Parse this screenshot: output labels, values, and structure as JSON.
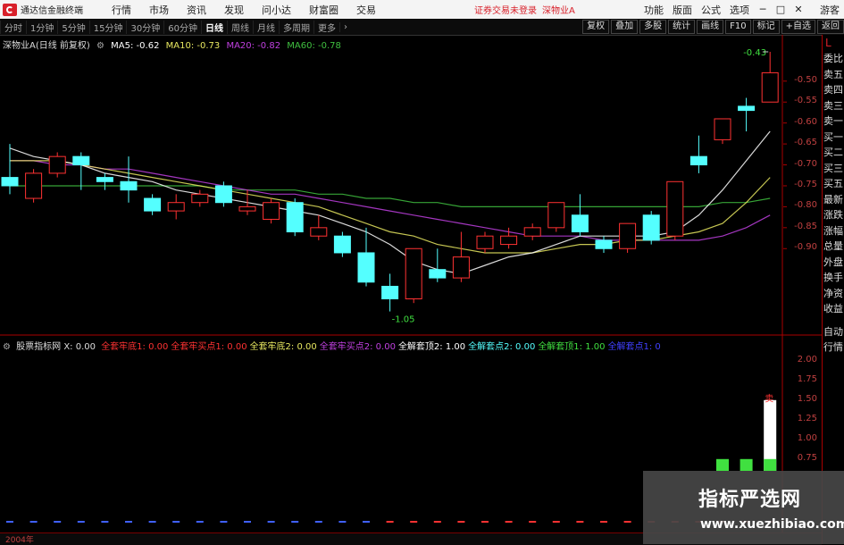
{
  "app": {
    "name": "通达信金融终端"
  },
  "menu": [
    "行情",
    "市场",
    "资讯",
    "发现",
    "问小达",
    "财富圈",
    "交易"
  ],
  "status": {
    "login": "证券交易未登录",
    "stock": "深物业A"
  },
  "menu_right": [
    "功能",
    "版面",
    "公式",
    "选项"
  ],
  "user": "游客",
  "periods": [
    "分时",
    "1分钟",
    "5分钟",
    "15分钟",
    "30分钟",
    "60分钟",
    "日线",
    "周线",
    "月线",
    "多周期",
    "更多"
  ],
  "active_period": "日线",
  "toolbar_right": [
    "复权",
    "叠加",
    "多股",
    "统计",
    "画线",
    "F10",
    "标记",
    "+自选",
    "返回"
  ],
  "sidebar": [
    "委比",
    "卖五",
    "卖四",
    "卖三",
    "卖一",
    "买一",
    "买二",
    "买三",
    "买五",
    "最新",
    "涨跌",
    "涨幅",
    "总量",
    "外盘",
    "换手",
    "净资",
    "收益",
    "自动",
    "行情"
  ],
  "sidebar_L": "L",
  "main_info": {
    "title": "深物业A(日线 前复权)",
    "ma5": "MA5: -0.62",
    "ma10": "MA10: -0.73",
    "ma20": "MA20: -0.82",
    "ma60": "MA60: -0.78"
  },
  "colors": {
    "ma5": "#ffffff",
    "ma10": "#e8e860",
    "ma20": "#c040e0",
    "ma60": "#40c040",
    "up": "#ff3232",
    "down": "#54ffff"
  },
  "price_axis": [
    "-0.50",
    "-0.55",
    "-0.60",
    "-0.65",
    "-0.70",
    "-0.75",
    "-0.80",
    "-0.85",
    "-0.90"
  ],
  "annotations": {
    "high": "-0.43",
    "low": "-1.05"
  },
  "indicator": {
    "name": "股票指标网 X: 0.00",
    "items": [
      {
        "text": "全套牢底1: 0.00",
        "color": "#ff3232"
      },
      {
        "text": "全套牢买点1: 0.00",
        "color": "#ff3232"
      },
      {
        "text": "全套牢底2: 0.00",
        "color": "#e8e860"
      },
      {
        "text": "全套牢买点2: 0.00",
        "color": "#c040e0"
      },
      {
        "text": "全解套顶2: 1.00",
        "color": "#ffffff"
      },
      {
        "text": "全解套点2: 0.00",
        "color": "#54ffff"
      },
      {
        "text": "全解套顶1: 1.00",
        "color": "#40e040"
      },
      {
        "text": "全解套点1: 0",
        "color": "#4040ff"
      }
    ]
  },
  "ind_axis": [
    "2.00",
    "1.75",
    "1.50",
    "1.25",
    "1.00",
    "0.75"
  ],
  "ind_label": "卖",
  "bottom_date": "2004年",
  "watermark": {
    "cn": "指标严选网",
    "url": "www.xuezhibiao.com"
  },
  "chart_data": {
    "type": "candlestick",
    "ylim": [
      -1.1,
      -0.43
    ],
    "candles": [
      {
        "o": -0.73,
        "c": -0.75,
        "h": -0.65,
        "l": -0.77
      },
      {
        "o": -0.78,
        "c": -0.72,
        "h": -0.71,
        "l": -0.79
      },
      {
        "o": -0.72,
        "c": -0.68,
        "h": -0.67,
        "l": -0.73
      },
      {
        "o": -0.68,
        "c": -0.7,
        "h": -0.67,
        "l": -0.76
      },
      {
        "o": -0.73,
        "c": -0.74,
        "h": -0.72,
        "l": -0.76
      },
      {
        "o": -0.74,
        "c": -0.76,
        "h": -0.68,
        "l": -0.79
      },
      {
        "o": -0.78,
        "c": -0.81,
        "h": -0.77,
        "l": -0.82
      },
      {
        "o": -0.81,
        "c": -0.79,
        "h": -0.77,
        "l": -0.83
      },
      {
        "o": -0.79,
        "c": -0.77,
        "h": -0.76,
        "l": -0.8
      },
      {
        "o": -0.75,
        "c": -0.79,
        "h": -0.74,
        "l": -0.8
      },
      {
        "o": -0.81,
        "c": -0.8,
        "h": -0.76,
        "l": -0.82
      },
      {
        "o": -0.83,
        "c": -0.79,
        "h": -0.78,
        "l": -0.84
      },
      {
        "o": -0.79,
        "c": -0.86,
        "h": -0.78,
        "l": -0.87
      },
      {
        "o": -0.87,
        "c": -0.85,
        "h": -0.82,
        "l": -0.88
      },
      {
        "o": -0.87,
        "c": -0.91,
        "h": -0.86,
        "l": -0.92
      },
      {
        "o": -0.91,
        "c": -0.98,
        "h": -0.85,
        "l": -0.99
      },
      {
        "o": -0.99,
        "c": -1.02,
        "h": -0.96,
        "l": -1.05
      },
      {
        "o": -1.02,
        "c": -0.9,
        "h": -0.9,
        "l": -1.03
      },
      {
        "o": -0.95,
        "c": -0.97,
        "h": -0.9,
        "l": -0.98
      },
      {
        "o": -0.97,
        "c": -0.92,
        "h": -0.86,
        "l": -0.98
      },
      {
        "o": -0.9,
        "c": -0.87,
        "h": -0.86,
        "l": -0.91
      },
      {
        "o": -0.89,
        "c": -0.87,
        "h": -0.85,
        "l": -0.9
      },
      {
        "o": -0.87,
        "c": -0.85,
        "h": -0.84,
        "l": -0.88
      },
      {
        "o": -0.85,
        "c": -0.79,
        "h": -0.79,
        "l": -0.86
      },
      {
        "o": -0.82,
        "c": -0.86,
        "h": -0.77,
        "l": -0.87
      },
      {
        "o": -0.88,
        "c": -0.9,
        "h": -0.87,
        "l": -0.91
      },
      {
        "o": -0.9,
        "c": -0.84,
        "h": -0.84,
        "l": -0.91
      },
      {
        "o": -0.82,
        "c": -0.88,
        "h": -0.81,
        "l": -0.89
      },
      {
        "o": -0.87,
        "c": -0.74,
        "h": -0.74,
        "l": -0.88
      },
      {
        "o": -0.68,
        "c": -0.7,
        "h": -0.63,
        "l": -0.72
      },
      {
        "o": -0.64,
        "c": -0.59,
        "h": -0.59,
        "l": -0.65
      },
      {
        "o": -0.56,
        "c": -0.57,
        "h": -0.54,
        "l": -0.62
      },
      {
        "o": -0.55,
        "c": -0.48,
        "h": -0.43,
        "l": -0.55
      }
    ],
    "ma5": [
      -0.66,
      -0.68,
      -0.69,
      -0.7,
      -0.72,
      -0.73,
      -0.74,
      -0.76,
      -0.77,
      -0.78,
      -0.79,
      -0.8,
      -0.81,
      -0.82,
      -0.84,
      -0.86,
      -0.89,
      -0.93,
      -0.95,
      -0.96,
      -0.94,
      -0.92,
      -0.91,
      -0.89,
      -0.87,
      -0.87,
      -0.87,
      -0.87,
      -0.86,
      -0.82,
      -0.76,
      -0.69,
      -0.62
    ],
    "ma10": [
      -0.69,
      -0.69,
      -0.69,
      -0.7,
      -0.71,
      -0.72,
      -0.73,
      -0.74,
      -0.75,
      -0.76,
      -0.77,
      -0.78,
      -0.79,
      -0.8,
      -0.82,
      -0.84,
      -0.86,
      -0.87,
      -0.89,
      -0.9,
      -0.91,
      -0.91,
      -0.91,
      -0.9,
      -0.89,
      -0.89,
      -0.88,
      -0.88,
      -0.87,
      -0.86,
      -0.84,
      -0.79,
      -0.73
    ],
    "ma20": [
      -0.69,
      -0.69,
      -0.7,
      -0.7,
      -0.71,
      -0.71,
      -0.72,
      -0.73,
      -0.74,
      -0.75,
      -0.76,
      -0.77,
      -0.77,
      -0.78,
      -0.79,
      -0.8,
      -0.81,
      -0.82,
      -0.83,
      -0.84,
      -0.85,
      -0.86,
      -0.87,
      -0.87,
      -0.87,
      -0.88,
      -0.88,
      -0.88,
      -0.88,
      -0.88,
      -0.87,
      -0.85,
      -0.82
    ],
    "ma60": [
      -0.75,
      -0.75,
      -0.75,
      -0.75,
      -0.75,
      -0.75,
      -0.75,
      -0.75,
      -0.75,
      -0.76,
      -0.76,
      -0.76,
      -0.76,
      -0.77,
      -0.77,
      -0.78,
      -0.78,
      -0.79,
      -0.79,
      -0.8,
      -0.8,
      -0.8,
      -0.8,
      -0.8,
      -0.8,
      -0.8,
      -0.8,
      -0.8,
      -0.8,
      -0.8,
      -0.79,
      -0.79,
      -0.78
    ],
    "indicator_bars": [
      {
        "index": 30,
        "value": 0.75,
        "color": "#40e040"
      },
      {
        "index": 31,
        "value": 0.75,
        "color": "#40e040"
      },
      {
        "index": 32,
        "value": 1.5,
        "color": "#ffffff"
      }
    ],
    "indicator_ylim": [
      0.6,
      2.1
    ]
  }
}
